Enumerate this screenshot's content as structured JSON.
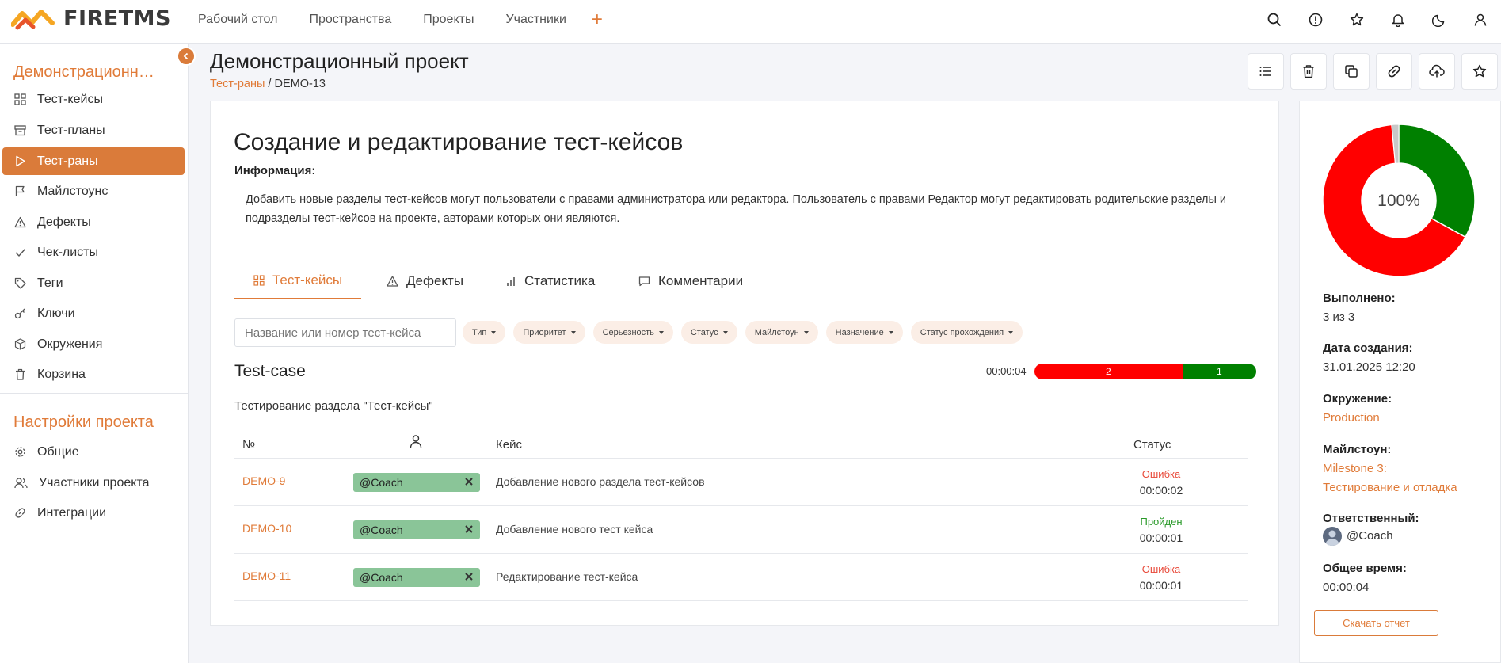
{
  "brand": {
    "name": "FIRETMS",
    "accent": "#e07b39"
  },
  "topnav": {
    "items": [
      "Рабочий стол",
      "Пространства",
      "Проекты",
      "Участники"
    ],
    "add_icon": "plus-icon"
  },
  "top_icons": [
    "search-icon",
    "alert-icon",
    "star-icon",
    "bell-icon",
    "moon-icon",
    "user-icon"
  ],
  "sidebar": {
    "project_title": "Демонстрационный проект",
    "items": [
      {
        "label": "Тест-кейсы",
        "icon": "grid-icon"
      },
      {
        "label": "Тест-планы",
        "icon": "archive-icon"
      },
      {
        "label": "Тест-раны",
        "icon": "play-icon",
        "active": true
      },
      {
        "label": "Майлстоунс",
        "icon": "flag-icon"
      },
      {
        "label": "Дефекты",
        "icon": "warning-icon"
      },
      {
        "label": "Чек-листы",
        "icon": "check-icon"
      },
      {
        "label": "Теги",
        "icon": "tag-icon"
      },
      {
        "label": "Ключи",
        "icon": "key-icon"
      },
      {
        "label": "Окружения",
        "icon": "box-icon"
      },
      {
        "label": "Корзина",
        "icon": "trash-icon"
      }
    ],
    "settings_title": "Настройки проекта",
    "settings_items": [
      {
        "label": "Общие",
        "icon": "gear-icon"
      },
      {
        "label": "Участники проекта",
        "icon": "users-icon"
      },
      {
        "label": "Интеграции",
        "icon": "link-icon"
      }
    ]
  },
  "header": {
    "title": "Демонстрационный проект",
    "breadcrumb_link": "Тест-раны",
    "breadcrumb_sep": " / ",
    "breadcrumb_current": "DEMO-13",
    "actions": [
      "list-icon",
      "trash-icon",
      "copy-icon",
      "link-icon",
      "cloud-upload-icon",
      "star-icon"
    ]
  },
  "run": {
    "title": "Создание и редактирование тест-кейсов",
    "info_label": "Информация:",
    "info_text": "Добавить новые разделы тест-кейсов могут пользователи с правами администратора или редактора. Пользователь с правами Редактор могут редактировать родительские разделы и подразделы тест-кейсов на проекте, авторами которых они являются.",
    "tabs": [
      {
        "label": "Тест-кейсы",
        "icon": "grid-icon",
        "active": true
      },
      {
        "label": "Дефекты",
        "icon": "warning-icon"
      },
      {
        "label": "Статистика",
        "icon": "bar-chart-icon"
      },
      {
        "label": "Комментарии",
        "icon": "comment-icon"
      }
    ],
    "search_placeholder": "Название или номер тест-кейса",
    "filters": [
      "Тип",
      "Приоритет",
      "Серьезность",
      "Статус",
      "Майлстоун",
      "Назначение",
      "Статус прохождения"
    ],
    "group_title": "Test-case",
    "total_time": "00:00:04",
    "progress": {
      "failed": 2,
      "passed": 1,
      "failed_color": "#ff0000",
      "passed_color": "#008000"
    },
    "section": "Тестирование раздела \"Тест-кейсы\"",
    "columns": {
      "num": "№",
      "assignee_icon": "user-icon",
      "case": "Кейс",
      "status": "Статус"
    },
    "rows": [
      {
        "id": "DEMO-9",
        "assignee": "@Coach",
        "name": "Добавление нового раздела тест-кейсов",
        "status": "Ошибка",
        "status_type": "fail",
        "time": "00:00:02"
      },
      {
        "id": "DEMO-10",
        "assignee": "@Coach",
        "name": "Добавление нового тест кейса",
        "status": "Пройден",
        "status_type": "pass",
        "time": "00:00:01"
      },
      {
        "id": "DEMO-11",
        "assignee": "@Coach",
        "name": "Редактирование тест-кейса",
        "status": "Ошибка",
        "status_type": "fail",
        "time": "00:00:01"
      }
    ]
  },
  "summary": {
    "donut_center": "100%",
    "donut_shares": {
      "failed": 0.655,
      "passed": 0.33,
      "other": 0.015
    },
    "done_label": "Выполнено:",
    "done_value": "3 из 3",
    "created_label": "Дата создания:",
    "created_value": "31.01.2025 12:20",
    "env_label": "Окружение:",
    "env_value": "Production",
    "milestone_label": "Майлстоун:",
    "milestone_line1": "Milestone 3:",
    "milestone_line2": "Тестирование и отладка",
    "owner_label": "Ответственный:",
    "owner_value": "@Coach",
    "time_label": "Общее время:",
    "time_value": "00:00:04",
    "download_label": "Скачать отчет"
  }
}
